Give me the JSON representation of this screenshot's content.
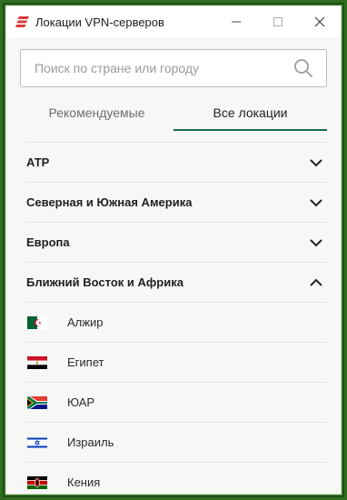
{
  "window": {
    "title": "Локации VPN-серверов",
    "controls": [
      "minimize",
      "maximize",
      "close"
    ]
  },
  "search": {
    "placeholder": "Поиск по стране или городу",
    "icon": "search-icon"
  },
  "tabs": [
    {
      "label": "Рекомендуемые",
      "active": false
    },
    {
      "label": "Все локации",
      "active": true
    }
  ],
  "regions": [
    {
      "label": "АТР",
      "expanded": false
    },
    {
      "label": "Северная и Южная Америка",
      "expanded": false
    },
    {
      "label": "Европа",
      "expanded": false
    },
    {
      "label": "Ближний Восток и Африка",
      "expanded": true
    }
  ],
  "countries": [
    {
      "label": "Алжир",
      "flag": "algeria-flag"
    },
    {
      "label": "Египет",
      "flag": "egypt-flag"
    },
    {
      "label": "ЮАР",
      "flag": "south-africa-flag"
    },
    {
      "label": "Израиль",
      "flag": "israel-flag"
    },
    {
      "label": "Кения",
      "flag": "kenya-flag"
    }
  ],
  "colors": {
    "accent": "#1c6b55",
    "brand": "#da3940",
    "background": "#f7f7f5",
    "outer_frame": "#3d8a2a"
  }
}
